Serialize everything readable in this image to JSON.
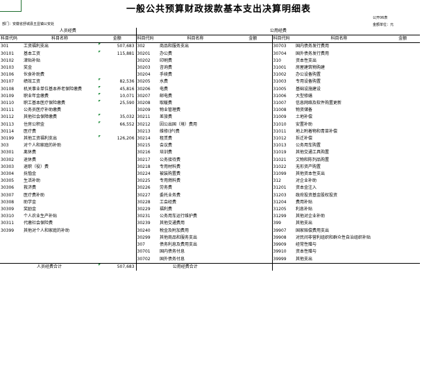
{
  "title": "一般公共预算财政拨款基本支出决算明细表",
  "form_no": "公开06表",
  "unit_label": "部门：安徽省舒城县五显镇公安处",
  "money_unit": "金额单位：元",
  "section_personnel": "人员经费",
  "section_public": "公用经费",
  "headers": {
    "code": "科目代码",
    "name": "科目名称",
    "amount": "金额"
  },
  "rows": [
    [
      "301",
      "工资福利支出",
      "507,683",
      "302",
      "商品和服务支出",
      "",
      "30703",
      "国内债务发行费用",
      ""
    ],
    [
      "30101",
      "基本工资",
      "115,881",
      "30201",
      "办公费",
      "",
      "30704",
      "国外债务发行费用",
      ""
    ],
    [
      "30102",
      "津贴补贴",
      "",
      "30202",
      "印刷费",
      "",
      "310",
      "资本性支出",
      ""
    ],
    [
      "30103",
      "奖金",
      "",
      "30203",
      "咨询费",
      "",
      "31001",
      "房屋建筑物购建",
      ""
    ],
    [
      "30106",
      "伙食补助费",
      "",
      "30204",
      "手续费",
      "",
      "31002",
      "办公设备购置",
      ""
    ],
    [
      "30107",
      "绩效工资",
      "82,536",
      "30205",
      "水费",
      "",
      "31003",
      "专用设备购置",
      ""
    ],
    [
      "30108",
      "机关事业单位基本养老保险缴费",
      "45,816",
      "30206",
      "电费",
      "",
      "31005",
      "基础设施建设",
      ""
    ],
    [
      "30109",
      "职业年金缴费",
      "10,071",
      "30207",
      "邮电费",
      "",
      "31006",
      "大型修缮",
      ""
    ],
    [
      "30110",
      "职工基本医疗保险缴费",
      "25,590",
      "30208",
      "取暖费",
      "",
      "31007",
      "信息网络及软件购置更新",
      ""
    ],
    [
      "30111",
      "公务员医疗补助缴费",
      "",
      "30209",
      "物业管理费",
      "",
      "31008",
      "物资储备",
      ""
    ],
    [
      "30112",
      "其他社会保障缴费",
      "35,032",
      "30211",
      "差旅费",
      "",
      "31009",
      "土地补偿",
      ""
    ],
    [
      "30113",
      "住房公积金",
      "66,552",
      "30212",
      "因公出国（境）费用",
      "",
      "31010",
      "安置补助",
      ""
    ],
    [
      "30114",
      "医疗费",
      "",
      "30213",
      "维修(护)费",
      "",
      "31011",
      "地上附着物和青苗补偿",
      ""
    ],
    [
      "30199",
      "其他工资福利支出",
      "126,206",
      "30214",
      "租赁费",
      "",
      "31012",
      "拆迁补偿",
      ""
    ],
    [
      "303",
      "对个人和家庭的补助",
      "",
      "30215",
      "会议费",
      "",
      "31013",
      "公务用车购置",
      ""
    ],
    [
      "30301",
      "离休费",
      "",
      "30216",
      "培训费",
      "",
      "31019",
      "其他交通工具购置",
      ""
    ],
    [
      "30302",
      "退休费",
      "",
      "30217",
      "公务接待费",
      "",
      "31021",
      "文物和陈列品购置",
      ""
    ],
    [
      "30303",
      "退职（役）费",
      "",
      "30218",
      "专用材料费",
      "",
      "31022",
      "无形资产购置",
      ""
    ],
    [
      "30304",
      "抚恤金",
      "",
      "30224",
      "被装购置费",
      "",
      "31099",
      "其他资本性支出",
      ""
    ],
    [
      "30305",
      "生活补助",
      "",
      "30225",
      "专用燃料费",
      "",
      "312",
      "对企业补助",
      ""
    ],
    [
      "30306",
      "救济费",
      "",
      "30226",
      "劳务费",
      "",
      "31201",
      "资本金注入",
      ""
    ],
    [
      "30307",
      "医疗费补助",
      "",
      "30227",
      "委托业务费",
      "",
      "31203",
      "政府投资基金股权投资",
      ""
    ],
    [
      "30308",
      "助学金",
      "",
      "30228",
      "工会经费",
      "",
      "31204",
      "费用补贴",
      ""
    ],
    [
      "30309",
      "奖励金",
      "",
      "30229",
      "福利费",
      "",
      "31205",
      "利息补贴",
      ""
    ],
    [
      "30310",
      "个人农业生产补贴",
      "",
      "30231",
      "公务用车运行维护费",
      "",
      "31299",
      "其他对企业补助",
      ""
    ],
    [
      "30311",
      "代缴社会保险费",
      "",
      "30239",
      "其他交通费用",
      "",
      "399",
      "其他支出",
      ""
    ],
    [
      "30399",
      "其他对个人和家庭的补助",
      "",
      "30240",
      "税金及附加费用",
      "",
      "39907",
      "国家赔偿费用支出",
      ""
    ],
    [
      "",
      "",
      "",
      "30299",
      "其他商品和服务支出",
      "",
      "39908",
      "对民间非营利组织和群众性自治组织补贴",
      ""
    ],
    [
      "",
      "",
      "",
      "307",
      "债务利息及费用支出",
      "",
      "39909",
      "经常性赠与",
      ""
    ],
    [
      "",
      "",
      "",
      "30701",
      "国内债务付息",
      "",
      "39910",
      "资本性赠与",
      ""
    ],
    [
      "",
      "",
      "",
      "30702",
      "国外债务付息",
      "",
      "39999",
      "其他支出",
      ""
    ]
  ],
  "totals": {
    "personnel_label": "人员经费合计",
    "personnel_value": "507,683",
    "public_label": "公用经费合计",
    "public_value": ""
  },
  "colors": {
    "grid": "#000000",
    "marker": "#1e8c3a"
  }
}
